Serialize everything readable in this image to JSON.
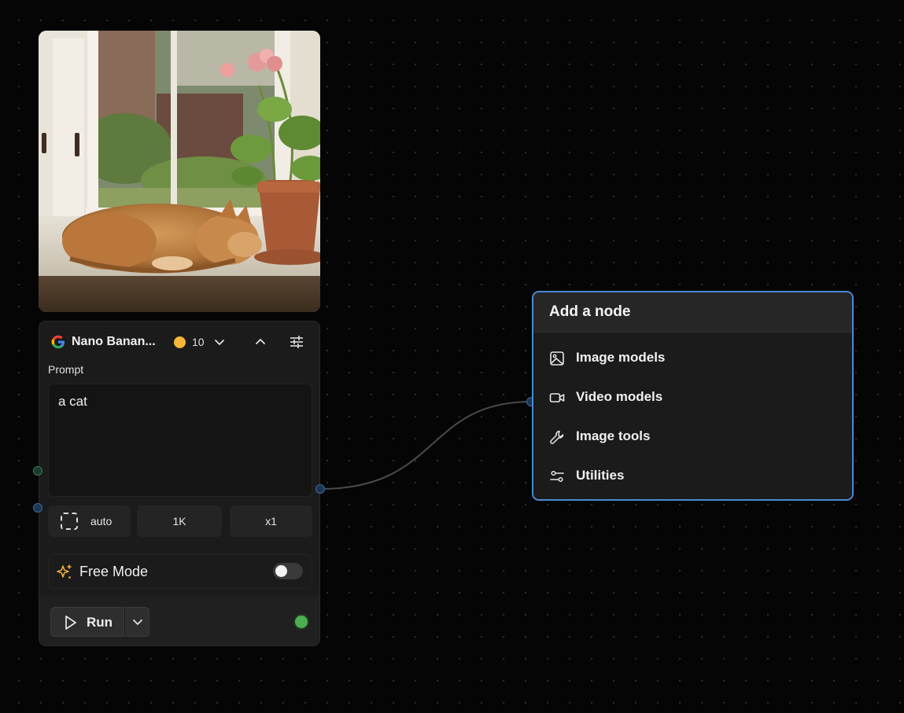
{
  "model_node": {
    "model_name": "Nano Banan...",
    "credits": "10",
    "prompt_label": "Prompt",
    "prompt_value": "a cat",
    "aspect_label": "auto",
    "resolution_label": "1K",
    "count_label": "x1",
    "free_mode_label": "Free Mode",
    "free_mode_enabled": false,
    "run_label": "Run",
    "status_color": "#4cae4f"
  },
  "add_node": {
    "title": "Add a node",
    "items": [
      {
        "label": "Image models",
        "icon": "image-icon"
      },
      {
        "label": "Video models",
        "icon": "video-camera-icon"
      },
      {
        "label": "Image tools",
        "icon": "wrench-icon"
      },
      {
        "label": "Utilities",
        "icon": "sliders-icon"
      }
    ]
  },
  "colors": {
    "accent": "#4a8ad4",
    "credit": "#f5b63a",
    "background": "#050505"
  }
}
